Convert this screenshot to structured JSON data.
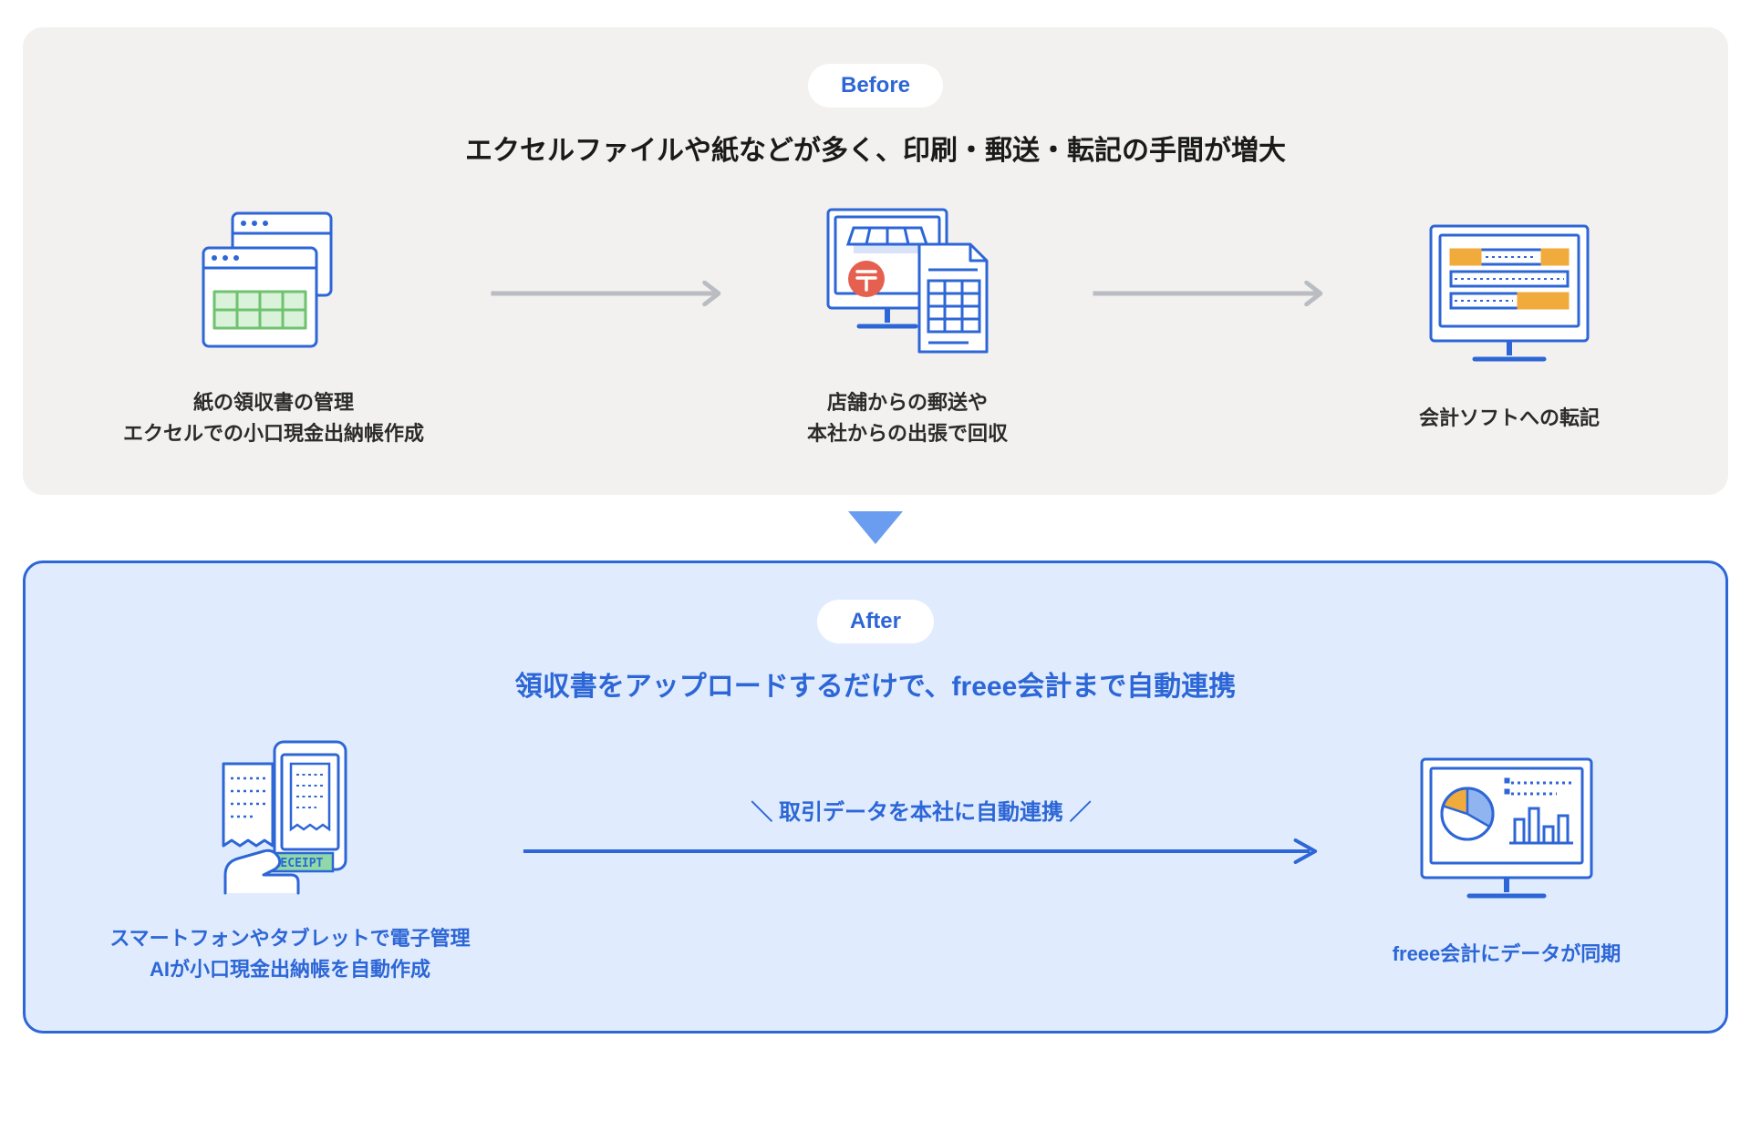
{
  "before": {
    "badge": "Before",
    "title": "エクセルファイルや紙などが多く、印刷・郵送・転記の手間が増大",
    "steps": [
      {
        "caption": "紙の領収書の管理\nエクセルでの小口現金出納帳作成"
      },
      {
        "caption": "店舗からの郵送や\n本社からの出張で回収"
      },
      {
        "caption": "会計ソフトへの転記"
      }
    ]
  },
  "after": {
    "badge": "After",
    "title": "領収書をアップロードするだけで、freee会計まで自動連携",
    "arrow_label": "＼ 取引データを本社に自動連携 ／",
    "steps": [
      {
        "caption": "スマートフォンやタブレットで電子管理\nAIが小口現金出納帳を自動作成"
      },
      {
        "caption": "freee会計にデータが同期"
      }
    ]
  },
  "colors": {
    "accent": "#2d66d6",
    "before_bg": "#f2f1ef",
    "after_bg": "#e0ecfe",
    "arrow_grey": "#b9bcc1",
    "green": "#6fc26f",
    "orange": "#f0ab3c",
    "red": "#e6604f"
  }
}
